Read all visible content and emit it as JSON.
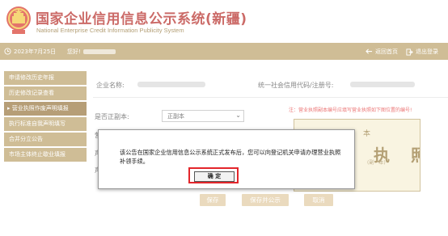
{
  "header": {
    "title_cn": "国家企业信用信息公示系统(新疆)",
    "title_en": "National Enterprise Credit Information Publicity System"
  },
  "topbar": {
    "date": "2023年7月25日",
    "user_prefix": "您好!",
    "home_label": "返回首页",
    "logout_label": "退出登录"
  },
  "sidebar": {
    "items": [
      {
        "label": "申请修改历史年报"
      },
      {
        "label": "历史修改记录查看"
      },
      {
        "label": "营业执照作废声明填报"
      },
      {
        "label": "执行标准自我声明填写"
      },
      {
        "label": "合并分立公告"
      },
      {
        "label": "市场主体终止歇业填报"
      }
    ],
    "active_index": 2
  },
  "form": {
    "company_name_label": "企业名称:",
    "credit_code_label": "统一社会信用代码/注册号:",
    "original_copy_label": "是否正副本:",
    "original_copy_value": "正副本",
    "row2_label": "营",
    "row3_label": "声",
    "row4_label": "声"
  },
  "notice": {
    "warning": "注：营业执照副本编号应填写营业执照如下图位置的编号!",
    "license_line1": "样　　本",
    "license_line2": "业　执　照",
    "license_line3": "(副　本)"
  },
  "actions": {
    "save": "保存",
    "save_publish": "保存并公示",
    "cancel": "取消"
  },
  "dialog": {
    "message": "该公告在国家企业信用信息公示系统正式发布后，您可以向登记机关申请办理营业执照补领手续。",
    "ok_label": "确 定"
  }
}
